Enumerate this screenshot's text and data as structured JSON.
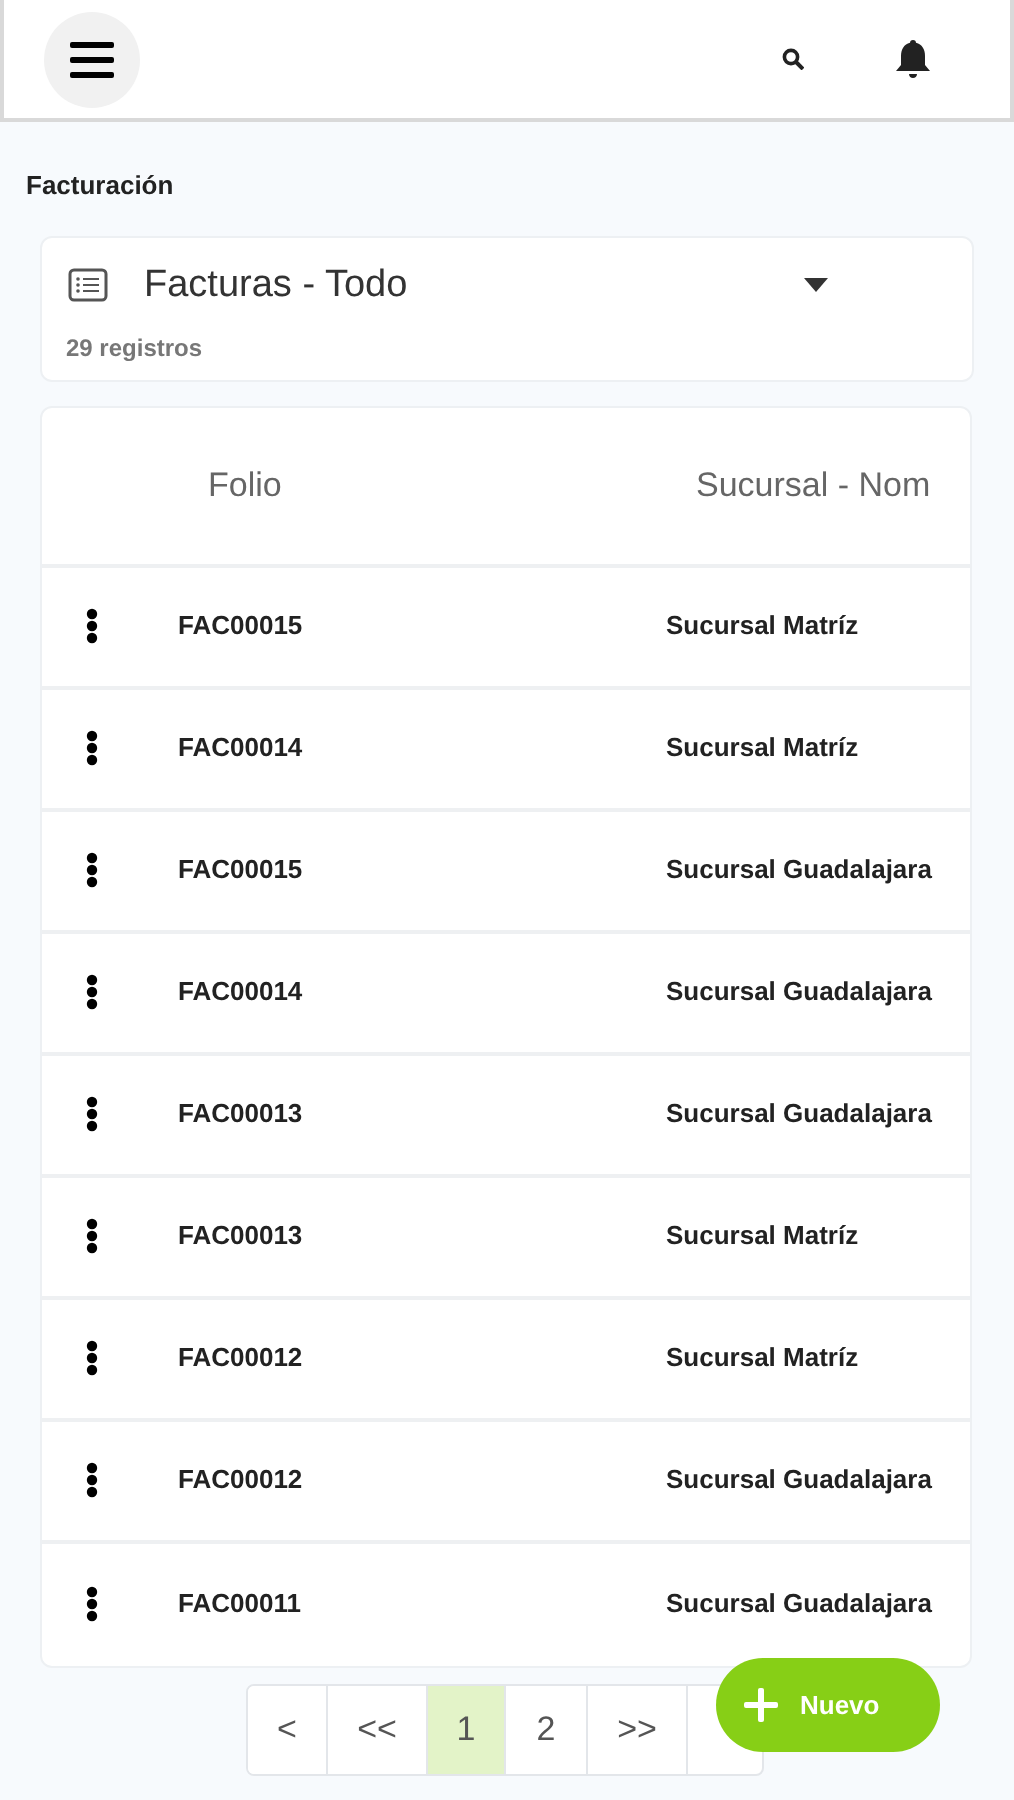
{
  "page_title": "Facturación",
  "view_selector": {
    "title": "Facturas - Todo",
    "count": "29 registros"
  },
  "table": {
    "columns": [
      "Folio",
      "Sucursal - Nom"
    ],
    "rows": [
      {
        "folio": "FAC00015",
        "sucursal": "Sucursal Matríz"
      },
      {
        "folio": "FAC00014",
        "sucursal": "Sucursal Matríz"
      },
      {
        "folio": "FAC00015",
        "sucursal": "Sucursal Guadalajara"
      },
      {
        "folio": "FAC00014",
        "sucursal": "Sucursal Guadalajara"
      },
      {
        "folio": "FAC00013",
        "sucursal": "Sucursal Guadalajara"
      },
      {
        "folio": "FAC00013",
        "sucursal": "Sucursal Matríz"
      },
      {
        "folio": "FAC00012",
        "sucursal": "Sucursal Matríz"
      },
      {
        "folio": "FAC00012",
        "sucursal": "Sucursal Guadalajara"
      },
      {
        "folio": "FAC00011",
        "sucursal": "Sucursal Guadalajara"
      }
    ]
  },
  "pagination": [
    {
      "label": "<",
      "selected": false
    },
    {
      "label": "<<",
      "selected": false
    },
    {
      "label": "1",
      "selected": true
    },
    {
      "label": "2",
      "selected": false
    },
    {
      "label": ">>",
      "selected": false
    }
  ],
  "fab": {
    "label": "Nuevo"
  }
}
